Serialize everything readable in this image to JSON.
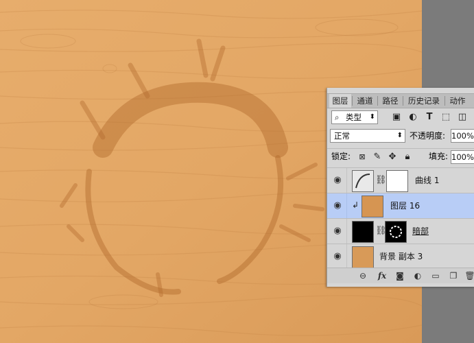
{
  "tabs": [
    {
      "label": "图层",
      "active": true
    },
    {
      "label": "通道",
      "active": false
    },
    {
      "label": "路径",
      "active": false
    },
    {
      "label": "历史记录",
      "active": false
    },
    {
      "label": "动作",
      "active": false
    }
  ],
  "filter": {
    "search_icon": "⌕",
    "kind_label": "类型",
    "dropdown_icon": "⬍"
  },
  "blend": {
    "mode": "正常",
    "opacity_label": "不透明度:",
    "opacity_value": "100%"
  },
  "lock": {
    "label": "锁定:",
    "fill_label": "填充:",
    "fill_value": "100%"
  },
  "layers": [
    {
      "name": "曲线 1",
      "type": "adjustment",
      "selected": false
    },
    {
      "name": "图层 16",
      "type": "image",
      "selected": true,
      "clipped": true
    },
    {
      "name": "暗部",
      "type": "masked",
      "selected": false
    },
    {
      "name": "背景 副本 3",
      "type": "image",
      "selected": false
    }
  ],
  "bottom_icons": [
    "link-icon",
    "fx-icon",
    "mask-icon",
    "adjustment-icon",
    "folder-icon",
    "new-layer-icon",
    "trash-icon"
  ],
  "colors": {
    "panel_bg": "#d6d6d6",
    "selected_row": "#b8cdf6",
    "wood": "#e0a464"
  }
}
